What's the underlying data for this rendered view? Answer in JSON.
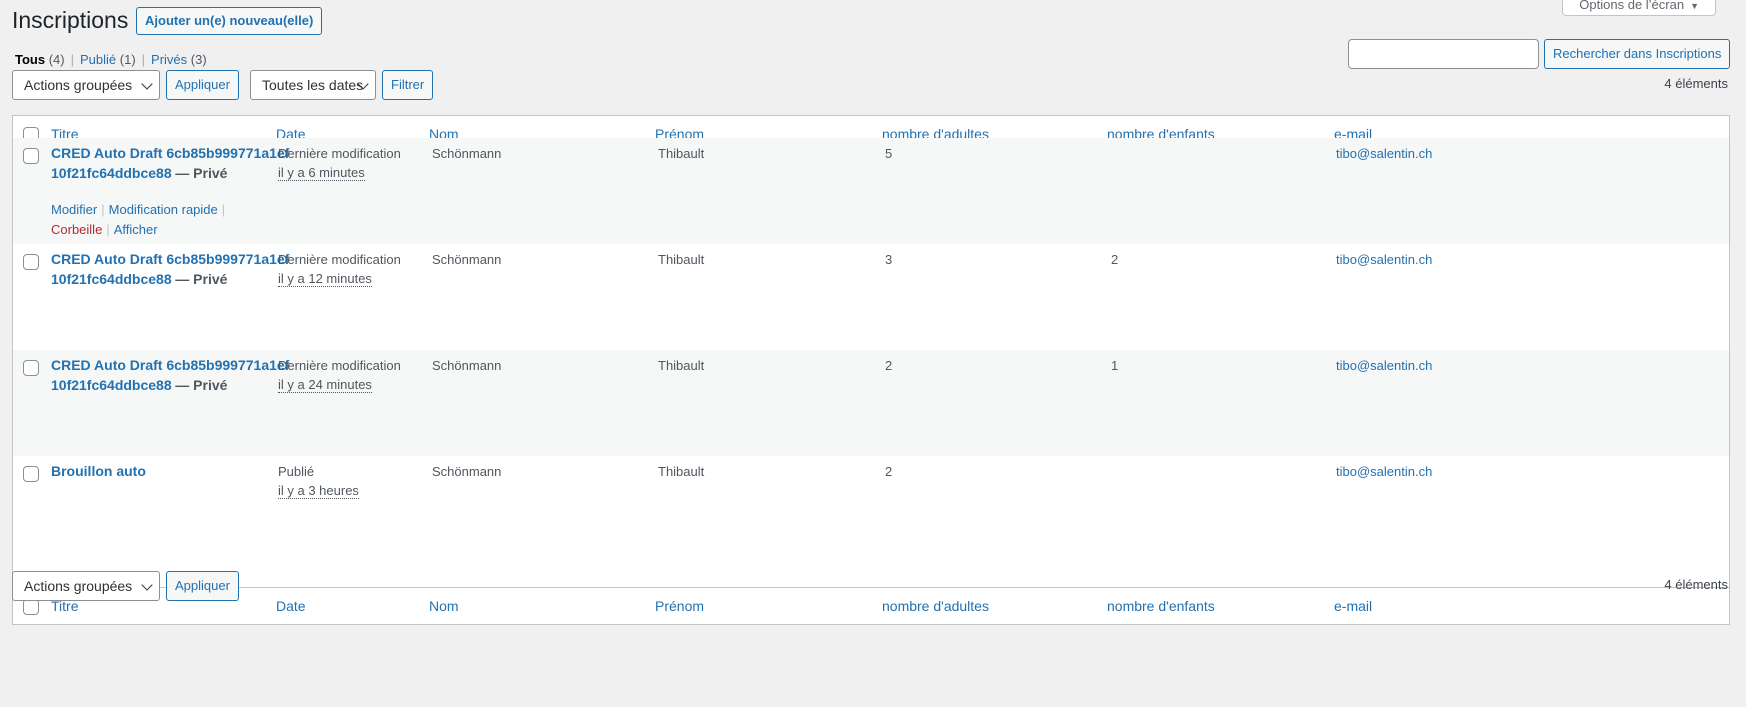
{
  "header": {
    "title": "Inscriptions",
    "add_new": "Ajouter un(e) nouveau(elle)",
    "screen_options": "Options de l’écran"
  },
  "views": [
    {
      "label": "Tous",
      "count": "(4)"
    },
    {
      "label": "Publié",
      "count": "(1)"
    },
    {
      "label": "Privés",
      "count": "(3)"
    }
  ],
  "search": {
    "value": "",
    "button": "Rechercher dans Inscriptions"
  },
  "tablenav_top": {
    "bulk_action": "Actions groupées",
    "apply": "Appliquer",
    "date_filter": "Toutes les dates",
    "filter": "Filtrer",
    "count": "4 éléments"
  },
  "tablenav_bottom": {
    "bulk_action": "Actions groupées",
    "apply": "Appliquer",
    "count": "4 éléments"
  },
  "columns": [
    "Titre",
    "Date",
    "Nom",
    "Prénom",
    "nombre d'adultes",
    "nombre d'enfants",
    "e-mail"
  ],
  "row_actions": {
    "edit": "Modifier",
    "quick_edit": "Modification rapide",
    "trash": "Corbeille",
    "view": "Afficher"
  },
  "rows": [
    {
      "title": "CRED Auto Draft 6cb85b999771a1ef10f21fc64ddbce88",
      "state": "— Privé",
      "date_status": "Dernière modification",
      "date_ago": "il y a 6 minutes",
      "nom": "Schönmann",
      "prenom": "Thibault",
      "adultes": "5",
      "enfants": "",
      "email": "tibo@salentin.ch"
    },
    {
      "title": "CRED Auto Draft 6cb85b999771a1ef10f21fc64ddbce88",
      "state": "— Privé",
      "date_status": "Dernière modification",
      "date_ago": "il y a 12 minutes",
      "nom": "Schönmann",
      "prenom": "Thibault",
      "adultes": "3",
      "enfants": "2",
      "email": "tibo@salentin.ch"
    },
    {
      "title": "CRED Auto Draft 6cb85b999771a1ef10f21fc64ddbce88",
      "state": "— Privé",
      "date_status": "Dernière modification",
      "date_ago": "il y a 24 minutes",
      "nom": "Schönmann",
      "prenom": "Thibault",
      "adultes": "2",
      "enfants": "1",
      "email": "tibo@salentin.ch"
    },
    {
      "title": "Brouillon auto",
      "state": "",
      "date_status": "Publié",
      "date_ago": "il y a 3 heures",
      "nom": "Schönmann",
      "prenom": "Thibault",
      "adultes": "2",
      "enfants": "",
      "email": "tibo@salentin.ch"
    }
  ]
}
